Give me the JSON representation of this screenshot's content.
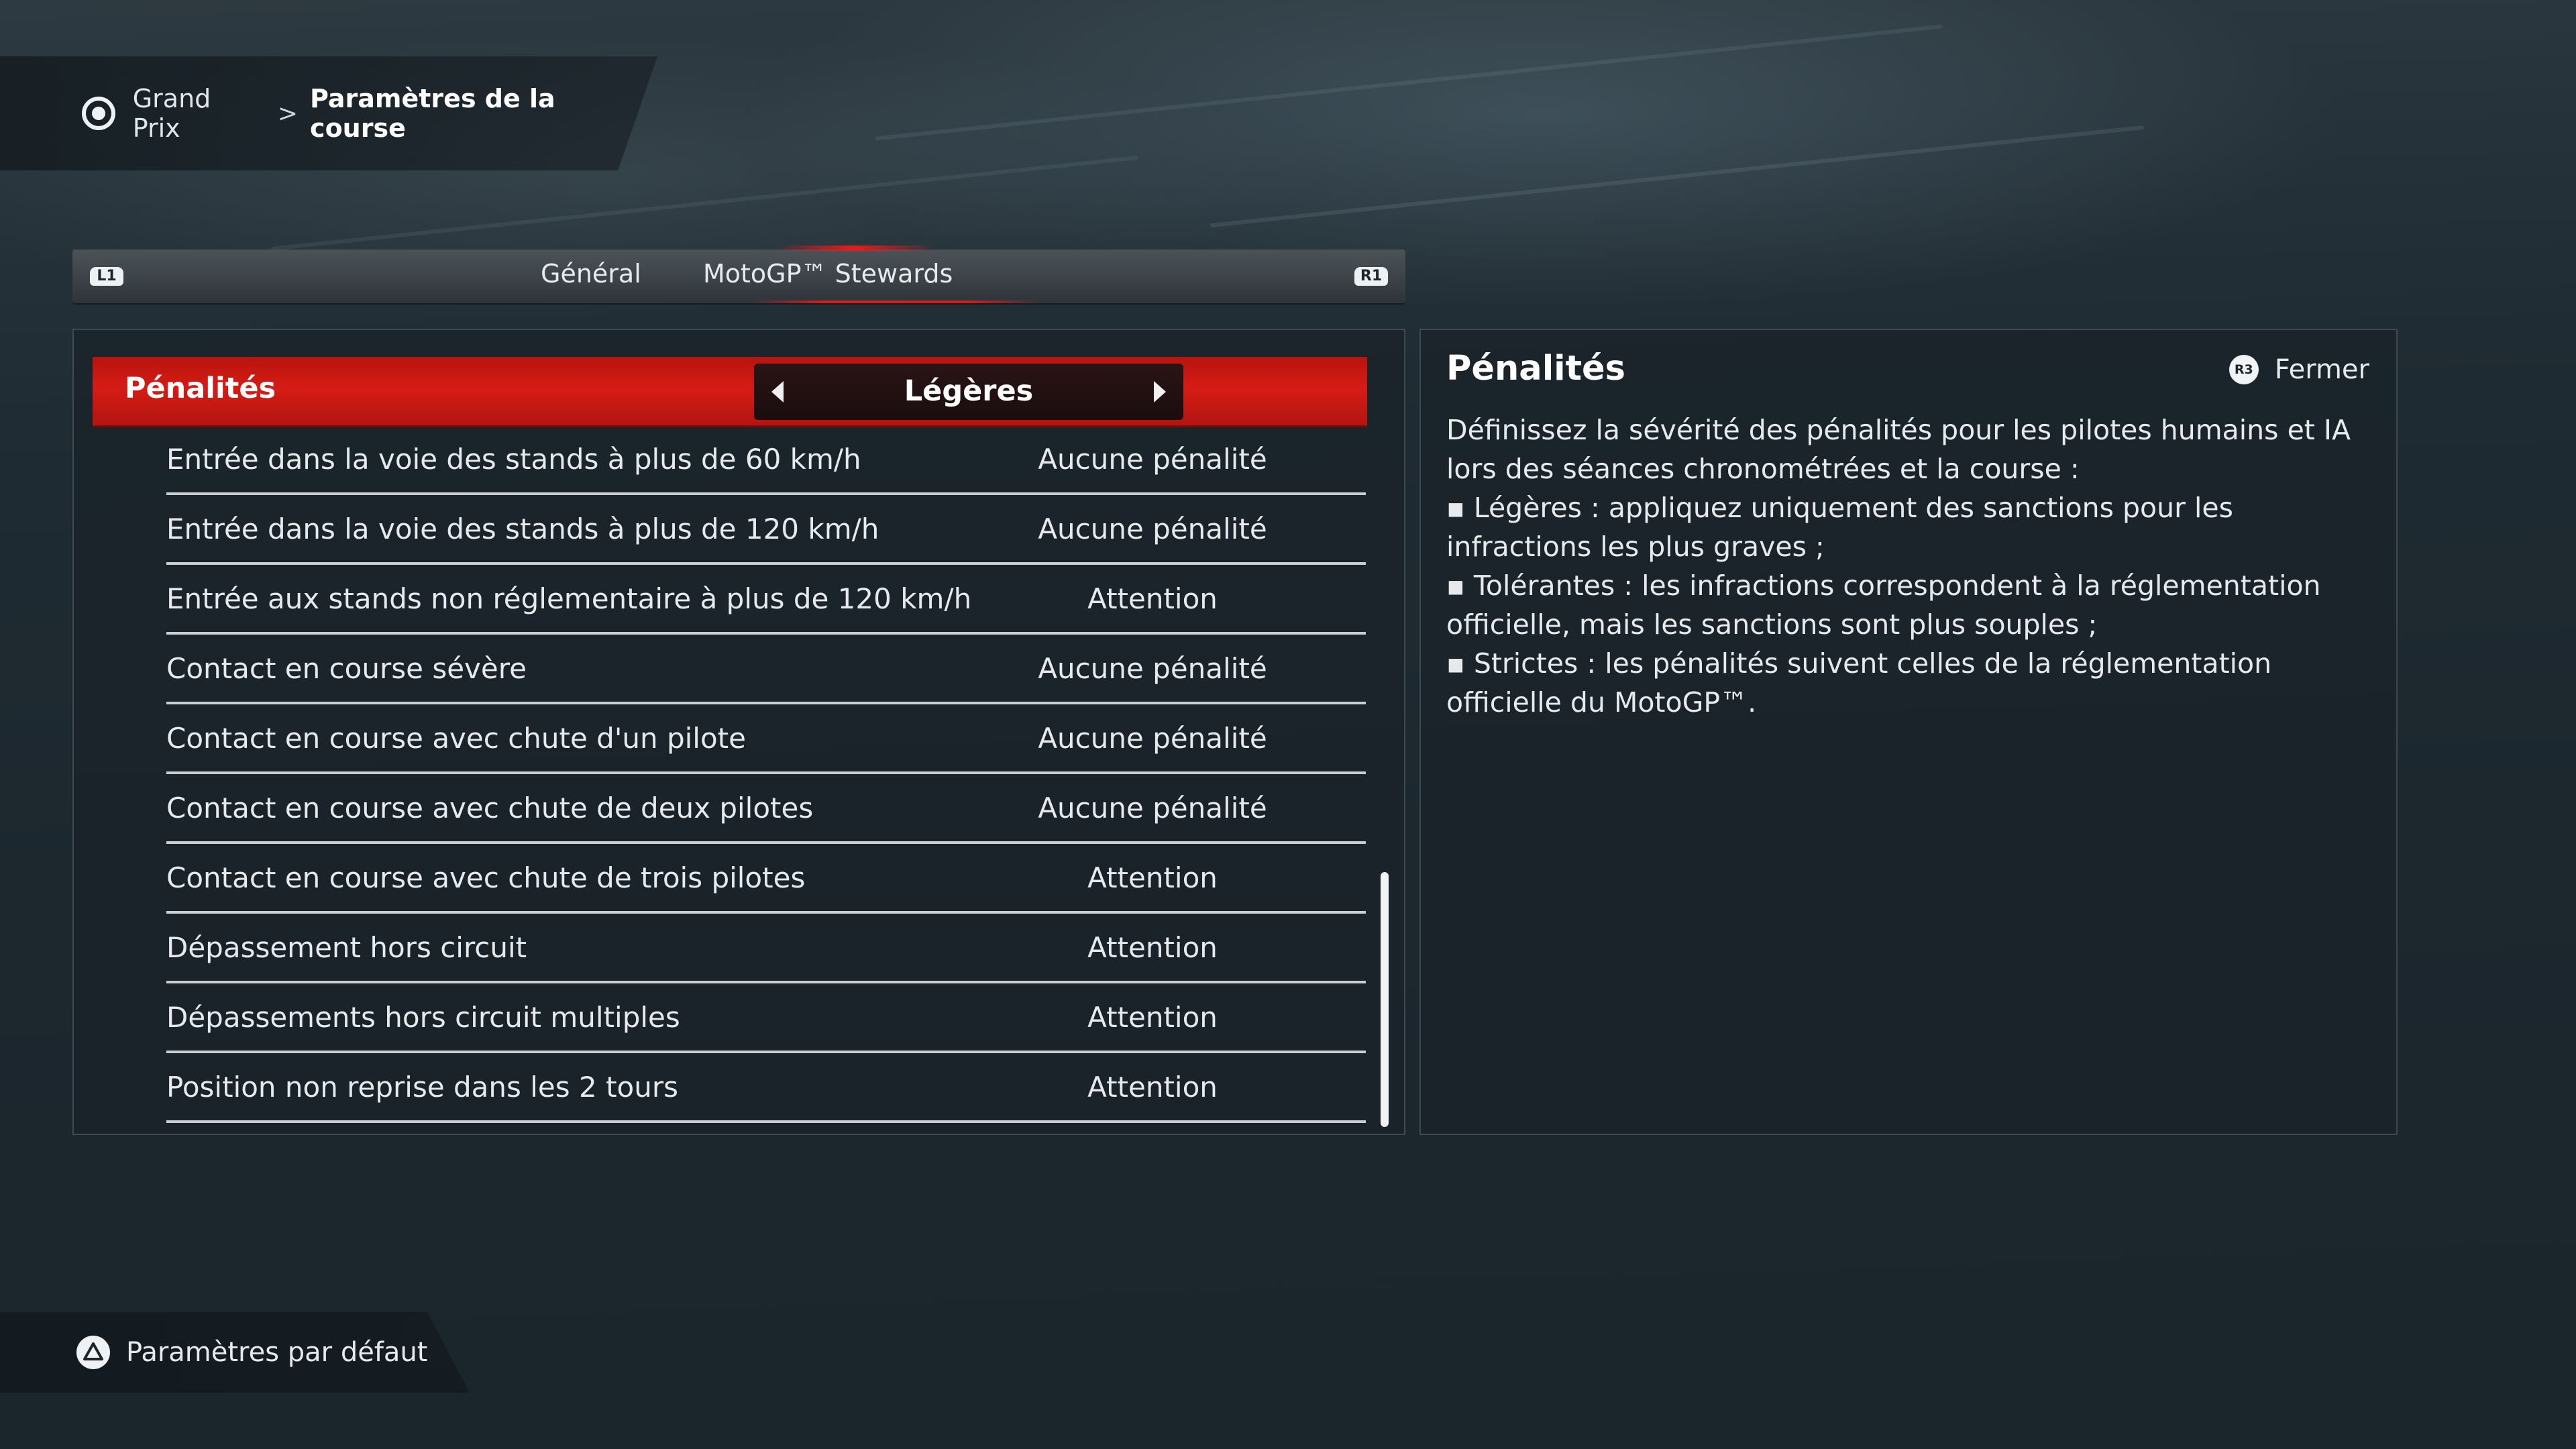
{
  "breadcrumb": {
    "parent": "Grand Prix",
    "separator": ">",
    "current": "Paramètres de la course"
  },
  "tabs": {
    "left_shoulder": "L1",
    "right_shoulder": "R1",
    "items": [
      {
        "label": "Général"
      },
      {
        "label": "MotoGP™ Stewards"
      }
    ],
    "active": "MotoGP™ Stewards"
  },
  "penalties": {
    "label": "Pénalités",
    "selected": "Légères"
  },
  "rows": [
    {
      "label": "Entrée dans la voie des stands à plus de 60 km/h",
      "value": "Aucune pénalité"
    },
    {
      "label": "Entrée dans la voie des stands à plus de 120 km/h",
      "value": "Aucune pénalité"
    },
    {
      "label": "Entrée aux stands non réglementaire à plus de 120 km/h",
      "value": "Attention"
    },
    {
      "label": "Contact en course sévère",
      "value": "Aucune pénalité"
    },
    {
      "label": "Contact en course avec chute d'un pilote",
      "value": "Aucune pénalité"
    },
    {
      "label": "Contact en course avec chute de deux pilotes",
      "value": "Aucune pénalité"
    },
    {
      "label": "Contact en course avec chute de trois pilotes",
      "value": "Attention"
    },
    {
      "label": "Dépassement hors circuit",
      "value": "Attention"
    },
    {
      "label": "Dépassements hors circuit multiples",
      "value": "Attention"
    },
    {
      "label": "Position non reprise dans les 2 tours",
      "value": "Attention"
    }
  ],
  "info": {
    "title": "Pénalités",
    "close_button_glyph": "R3",
    "close_label": "Fermer",
    "intro": "Définissez la sévérité des pénalités pour les pilotes humains et IA lors des séances chronométrées et la course :",
    "bullets": [
      "▪ Légères : appliquez uniquement des sanctions pour les infractions les plus graves ;",
      "▪ Tolérantes : les infractions correspondent à la réglementation officielle, mais les sanctions sont plus souples ;",
      "▪ Strictes : les pénalités suivent celles de la réglementation officielle du MotoGP™."
    ]
  },
  "footer": {
    "default_label": "Paramètres par défaut"
  },
  "icons": {
    "breadcrumb": "circle-button-icon",
    "footer": "triangle-button-icon"
  },
  "colors": {
    "accent_red": "#d51c14",
    "panel_bg": "#1a2329",
    "text": "#e6eaed"
  }
}
